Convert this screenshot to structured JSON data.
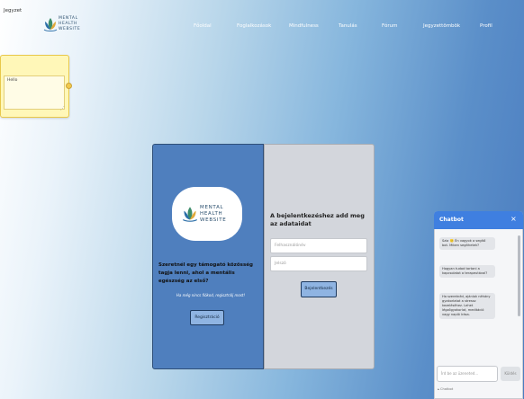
{
  "header": {
    "logo_lines": "MENTAL\nHEALTH\nWEBSITE",
    "nav": [
      "Főoldal",
      "Foglalkozások",
      "Mindfulness",
      "Tanulás",
      "Fórum",
      "Jegyzettömbök",
      "Profil"
    ]
  },
  "note": {
    "title": "Jegyzet",
    "body": "Hello"
  },
  "login": {
    "logo_lines": "MENTAL\nHEALTH\nWEBSITE",
    "left_heading": "Szeretnél egy támogató közösség tagja lenni, ahol a mentális egészség az első?",
    "left_sub": "Ha még nincs fiókod, regisztrálj most!",
    "register_label": "Regisztráció",
    "right_heading": "A bejelentkezéshez add meg az adataidat",
    "username_placeholder": "Felhasználónév",
    "password_placeholder": "Jelszó",
    "login_label": "Bejelentkezés"
  },
  "chatbot": {
    "title": "Chatbot",
    "messages": [
      "Szia 🙂 Én vagyok a segítő bot. Miben segíthetek?",
      "Hogyan tudod tartani a kapcsolatot a terapeutával?",
      "Ha szeretnéd, ajánlok néhány gyakorlatot a stressz kezeléséhez. Lehet légzőgyakorlat, meditáció vagy napló írása."
    ],
    "input_placeholder": "Írd be az üzeneted...",
    "send_label": "Küldés",
    "footer": "Chatbot"
  }
}
